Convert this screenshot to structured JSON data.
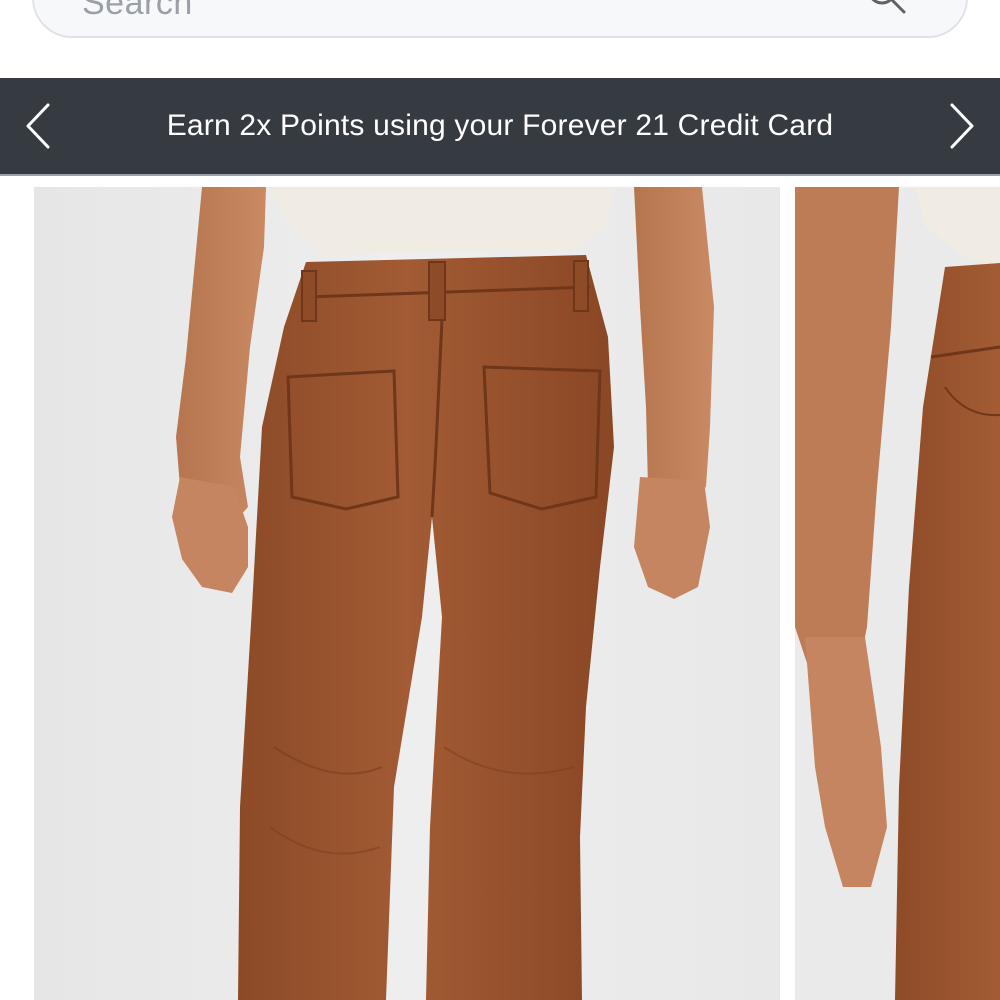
{
  "search": {
    "placeholder": "Search",
    "icon": "search-icon"
  },
  "promo": {
    "text": "Earn 2x Points using your Forever 21 Credit Card",
    "prev_icon": "chevron-left-icon",
    "next_icon": "chevron-right-icon",
    "background_color": "#363b42",
    "text_color": "#ffffff"
  },
  "carousel": {
    "slides": [
      {
        "alt": "product-image-back-view"
      },
      {
        "alt": "product-image-side-view"
      }
    ],
    "product_color": "#9a5530"
  }
}
